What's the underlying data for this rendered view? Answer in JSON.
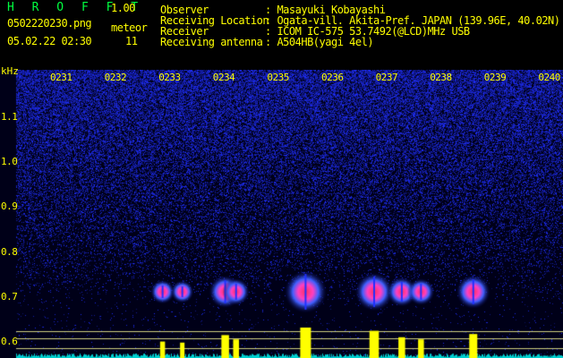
{
  "app": {
    "name": "H R O F F T",
    "version": "1.00",
    "filename": "0502220230.png",
    "datetime": "05.02.22 02:30",
    "meteor_label": "meteor",
    "meteor_count": "11"
  },
  "info": {
    "observer_label": "Observer",
    "observer_value": ": Masayuki Kobayashi",
    "location_label": "Receiving Location",
    "location_value": ": Ogata-vill. Akita-Pref. JAPAN (139.96E, 40.02N)",
    "receiver_label": "Receiver",
    "receiver_value": ": ICOM IC-575 53.7492(@LCD)MHz USB",
    "antenna_label": "Receiving antenna",
    "antenna_value": ": A504HB(yagi 4el)"
  },
  "spectrogram": {
    "unit": "kHz",
    "time_ticks": [
      "0231",
      "0232",
      "0233",
      "0234",
      "0235",
      "0236",
      "0237",
      "0238",
      "0239",
      "0240"
    ],
    "freq_ticks": [
      "1.1",
      "1.0",
      "0.9",
      "0.8",
      "0.7",
      "0.6"
    ],
    "echoes": [
      {
        "t": 0.228,
        "strength": 0.35
      },
      {
        "t": 0.268,
        "strength": 0.3
      },
      {
        "t": 0.355,
        "strength": 0.65
      },
      {
        "t": 0.377,
        "strength": 0.45
      },
      {
        "t": 0.518,
        "strength": 1.0
      },
      {
        "t": 0.657,
        "strength": 0.85
      },
      {
        "t": 0.713,
        "strength": 0.55
      },
      {
        "t": 0.752,
        "strength": 0.45
      },
      {
        "t": 0.858,
        "strength": 0.7
      }
    ],
    "colors": {
      "background": "#000018",
      "noise": "#2030ff",
      "echo_core": "#ff3060",
      "level_line": "#ffff00",
      "baseline": "#00d0d0"
    }
  }
}
